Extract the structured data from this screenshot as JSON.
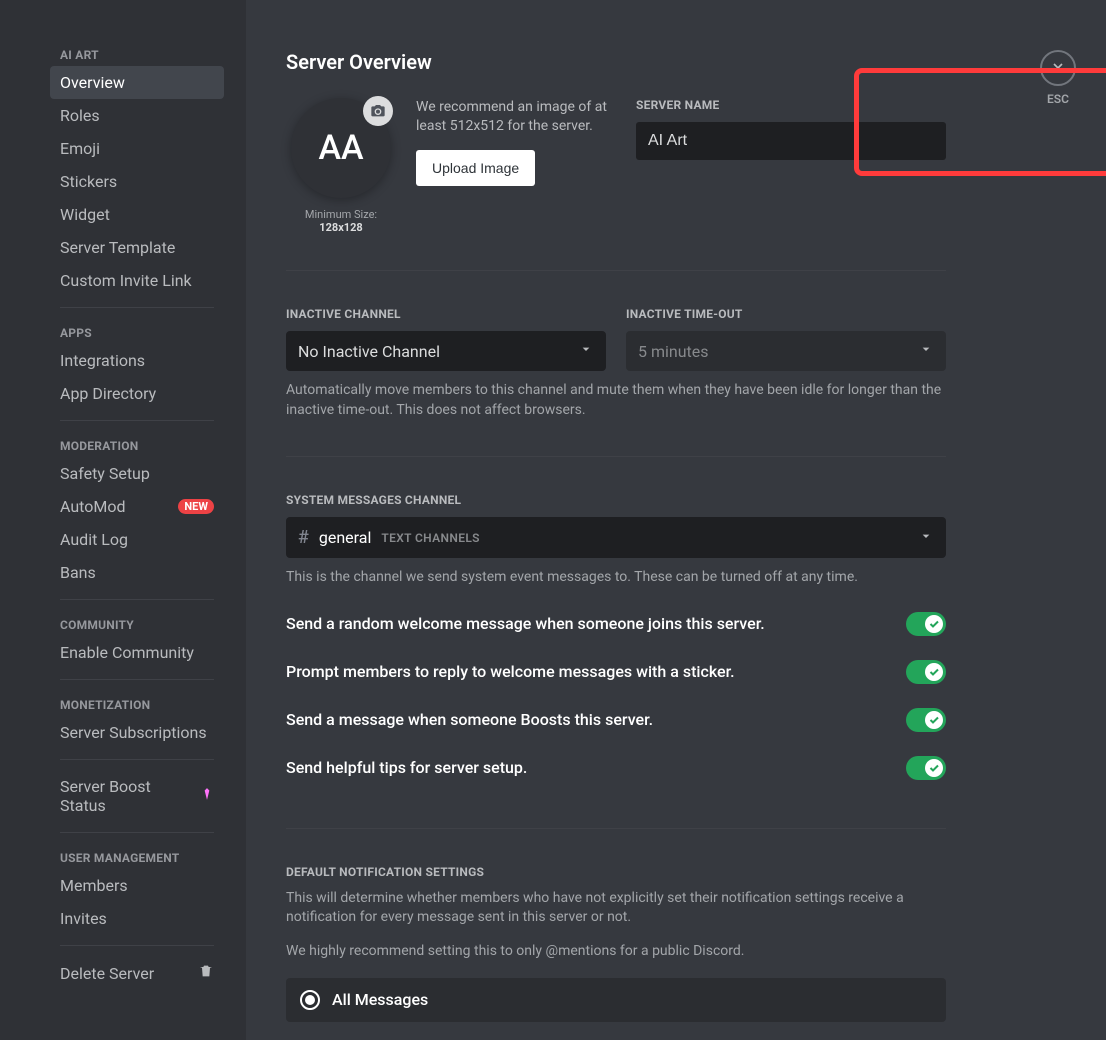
{
  "sidebar": {
    "sections": [
      {
        "header": "AI ART",
        "items": [
          {
            "label": "Overview",
            "active": true,
            "name": "sidebar-item-overview"
          },
          {
            "label": "Roles",
            "name": "sidebar-item-roles"
          },
          {
            "label": "Emoji",
            "name": "sidebar-item-emoji"
          },
          {
            "label": "Stickers",
            "name": "sidebar-item-stickers"
          },
          {
            "label": "Widget",
            "name": "sidebar-item-widget"
          },
          {
            "label": "Server Template",
            "name": "sidebar-item-server-template"
          },
          {
            "label": "Custom Invite Link",
            "name": "sidebar-item-custom-invite"
          }
        ]
      },
      {
        "header": "APPS",
        "items": [
          {
            "label": "Integrations",
            "name": "sidebar-item-integrations"
          },
          {
            "label": "App Directory",
            "name": "sidebar-item-app-directory"
          }
        ]
      },
      {
        "header": "MODERATION",
        "items": [
          {
            "label": "Safety Setup",
            "name": "sidebar-item-safety-setup"
          },
          {
            "label": "AutoMod",
            "badge": "NEW",
            "name": "sidebar-item-automod"
          },
          {
            "label": "Audit Log",
            "name": "sidebar-item-audit-log"
          },
          {
            "label": "Bans",
            "name": "sidebar-item-bans"
          }
        ]
      },
      {
        "header": "COMMUNITY",
        "items": [
          {
            "label": "Enable Community",
            "name": "sidebar-item-enable-community"
          }
        ]
      },
      {
        "header": "MONETIZATION",
        "items": [
          {
            "label": "Server Subscriptions",
            "name": "sidebar-item-server-subscriptions"
          }
        ]
      },
      {
        "header": null,
        "items": [
          {
            "label": "Server Boost Status",
            "gem": true,
            "name": "sidebar-item-boost-status"
          }
        ]
      },
      {
        "header": "USER MANAGEMENT",
        "items": [
          {
            "label": "Members",
            "name": "sidebar-item-members"
          },
          {
            "label": "Invites",
            "name": "sidebar-item-invites"
          }
        ]
      },
      {
        "header": null,
        "items": [
          {
            "label": "Delete Server",
            "trash": true,
            "name": "sidebar-item-delete-server"
          }
        ]
      }
    ]
  },
  "page_title": "Server Overview",
  "avatar_initials": "AA",
  "min_size_prefix": "Minimum Size: ",
  "min_size_value": "128x128",
  "recommend_text": "We recommend an image of at least 512x512 for the server.",
  "upload_btn": "Upload Image",
  "server_name_label": "SERVER NAME",
  "server_name_value": "AI Art",
  "inactive_channel_label": "INACTIVE CHANNEL",
  "inactive_channel_value": "No Inactive Channel",
  "inactive_timeout_label": "INACTIVE TIME-OUT",
  "inactive_timeout_value": "5 minutes",
  "inactive_help": "Automatically move members to this channel and mute them when they have been idle for longer than the inactive time-out. This does not affect browsers.",
  "sys_label": "SYSTEM MESSAGES CHANNEL",
  "sys_channel": "general",
  "sys_category": "TEXT CHANNELS",
  "sys_help": "This is the channel we send system event messages to. These can be turned off at any time.",
  "toggles": [
    {
      "label": "Send a random welcome message when someone joins this server.",
      "on": true
    },
    {
      "label": "Prompt members to reply to welcome messages with a sticker.",
      "on": true
    },
    {
      "label": "Send a message when someone Boosts this server.",
      "on": true
    },
    {
      "label": "Send helpful tips for server setup.",
      "on": true
    }
  ],
  "notif_label": "DEFAULT NOTIFICATION SETTINGS",
  "notif_help1": "This will determine whether members who have not explicitly set their notification settings receive a notification for every message sent in this server or not.",
  "notif_help2": "We highly recommend setting this to only @mentions for a public Discord.",
  "radio_all": "All Messages",
  "esc": "ESC"
}
